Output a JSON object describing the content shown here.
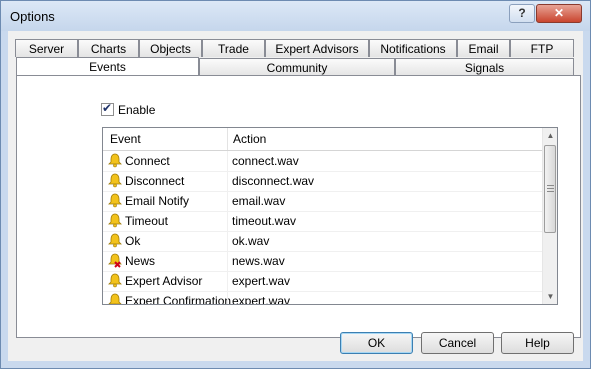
{
  "window": {
    "title": "Options",
    "help_glyph": "?",
    "close_glyph": "✕"
  },
  "tabs_row1": [
    "Server",
    "Charts",
    "Objects",
    "Trade",
    "Expert Advisors",
    "Notifications",
    "Email",
    "FTP"
  ],
  "tabs_row2": [
    "Events",
    "Community",
    "Signals"
  ],
  "active_tab": "Events",
  "enable": {
    "label": "Enable",
    "checked": true
  },
  "list": {
    "columns": [
      "Event",
      "Action"
    ],
    "rows": [
      {
        "event": "Connect",
        "action": "connect.wav",
        "icon": "bell-icon"
      },
      {
        "event": "Disconnect",
        "action": "disconnect.wav",
        "icon": "bell-icon"
      },
      {
        "event": "Email Notify",
        "action": "email.wav",
        "icon": "bell-icon"
      },
      {
        "event": "Timeout",
        "action": "timeout.wav",
        "icon": "bell-icon"
      },
      {
        "event": "Ok",
        "action": "ok.wav",
        "icon": "bell-icon"
      },
      {
        "event": "News",
        "action": "news.wav",
        "icon": "bell-disabled-icon"
      },
      {
        "event": "Expert Advisor",
        "action": "expert.wav",
        "icon": "bell-icon"
      },
      {
        "event": "Expert Confirmation",
        "action": "expert.wav",
        "icon": "bell-icon"
      }
    ]
  },
  "buttons": {
    "ok": "OK",
    "cancel": "Cancel",
    "help": "Help"
  },
  "colors": {
    "bell": "#f2c21b",
    "disabled_x": "#d0021b"
  }
}
